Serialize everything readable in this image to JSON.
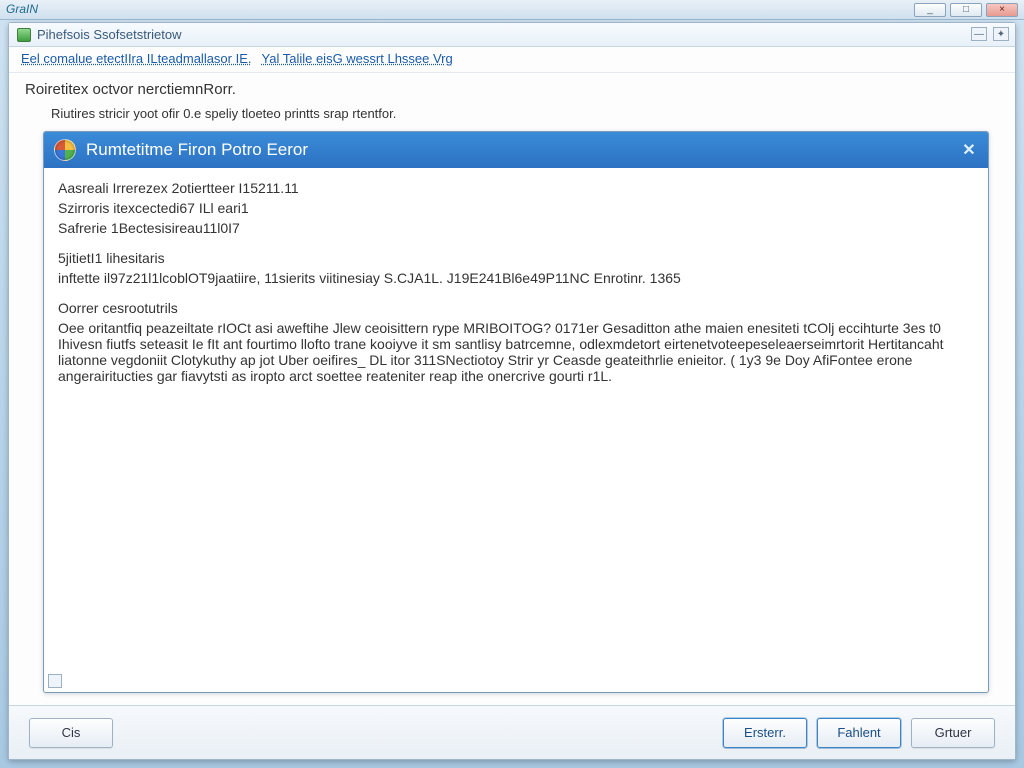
{
  "os": {
    "top_label": "GraIN",
    "minimize": "_",
    "maximize": "□",
    "close": "×"
  },
  "window": {
    "titlebar_text": "Pihefsois Ssofsetstrietow",
    "titlebar_controls": {
      "min": "—",
      "plus": "✦"
    },
    "subnav": {
      "item1": "Eel comalue etectIIra ILteadmallasor IE.",
      "item2": "Yal Talile eisG wessrt Lhssee Vrg"
    },
    "heading": "Roiretitex octvor nerctiemnRorr.",
    "subheading": "Riutires stricir yoot ofir 0.e speliy tloeteo printts srap rtentfor."
  },
  "error_panel": {
    "title": "Rumtetitme Firon Potro Eeror",
    "body": {
      "l1": "Aasreali Irrerezex 2otiertteer I15211.11",
      "l2": "Szirroris itexcectedi67 ILl eari1",
      "l3": "Safrerie 1Bectesisireau11l0I7",
      "l4": "5jitietI1 lihesitaris",
      "l5": "inftette il97z21l1lcoblOT9jaatiire, 11sierits viitinesiay S.CJA1L. J19E241Bl6e49P11NC Enrotinr. 1365",
      "l6": "Oorrer cesrootutrils",
      "l7": "Oee oritantfiq peazeiltate rIOCt asi aweftihe Jlew ceoisittern rype MRIBOITOG? 0171er Gesaditton athe maien enesiteti tCOlj eccihturte 3es t0 Ihivesn fiutfs seteasit Ie fIt ant fourtimo llofto trane kooiyve it sm santlisy batrcemne, odlexmdetort eirtenetvoteepeseleaerseimrtorit Hertitancaht liatonne vegdoniit Clotykuthy ap jot Uber oeifires_ DL itor 311SNectiotoy Strir yr Ceasde geateithrlie enieitor. ( 1y3 9e Doy AfiFontee erone angerairitucties gar fiavytsti as iropto arct soettee reateniter reap ithe onercrive gourti r1L."
    }
  },
  "footer": {
    "left": "Cis",
    "right1": "Ersterr.",
    "right2": "Fahlent",
    "right3": "Grtuer"
  }
}
